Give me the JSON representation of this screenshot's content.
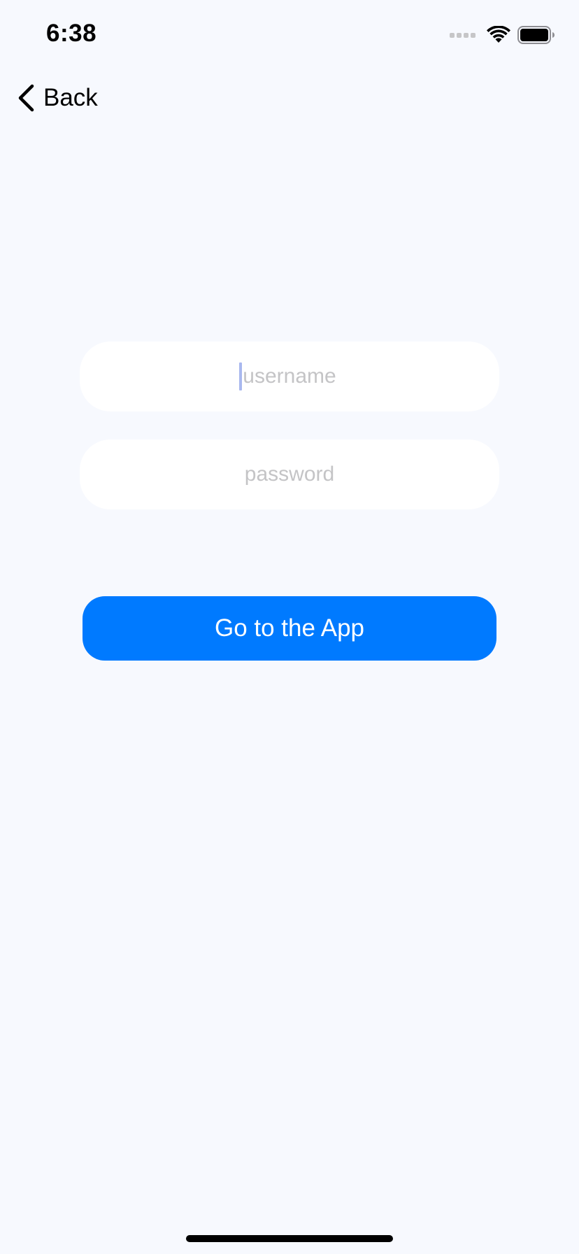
{
  "status_bar": {
    "time": "6:38"
  },
  "nav": {
    "back_label": "Back",
    "back_icon": "chevron-left-icon"
  },
  "form": {
    "username": {
      "placeholder": "username",
      "value": ""
    },
    "password": {
      "placeholder": "password",
      "value": ""
    },
    "submit_label": "Go to the App"
  },
  "colors": {
    "background": "#F7F9FE",
    "field": "#FFFFFF",
    "accent": "#007AFF",
    "placeholder": "#C4C4C6",
    "caret": "#A9B8EF"
  }
}
